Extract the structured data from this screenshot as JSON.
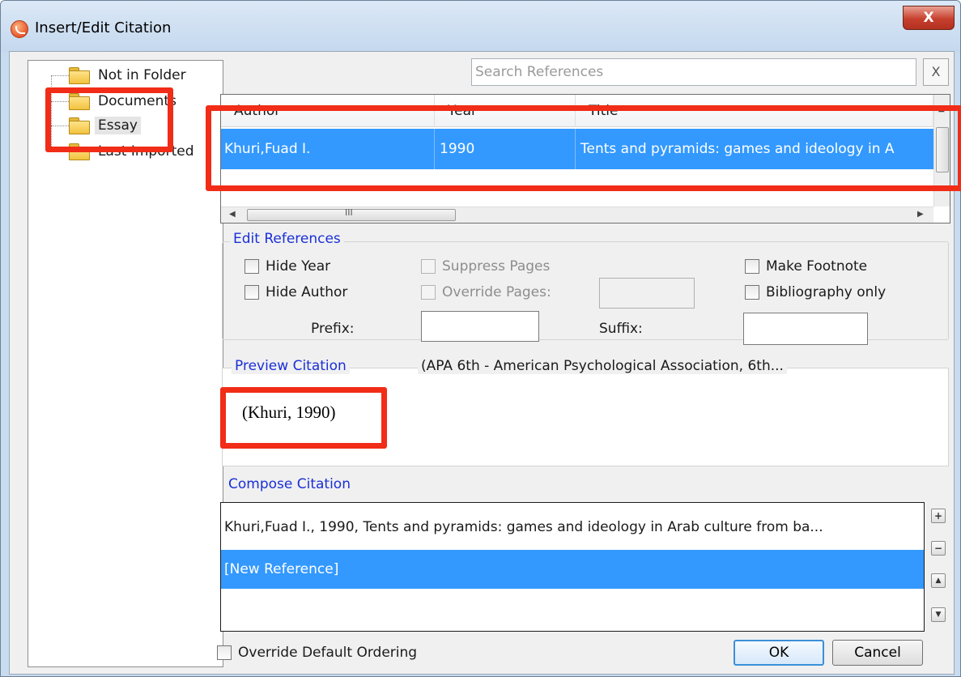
{
  "window": {
    "title": "Insert/Edit Citation",
    "close_label": "X"
  },
  "tree": {
    "items": [
      {
        "label": "Not in Folder"
      },
      {
        "label": "Documents"
      },
      {
        "label": "Essay"
      },
      {
        "label": "Last Imported"
      }
    ]
  },
  "search": {
    "placeholder": "Search References",
    "clear_label": "X"
  },
  "references": {
    "columns": [
      "Author",
      "Year",
      "Title"
    ],
    "rows": [
      {
        "author": "Khuri,Fuad I.",
        "year": "1990",
        "title": "Tents and pyramids: games and ideology in A"
      }
    ],
    "scroll_grip": "III"
  },
  "edit_references": {
    "title": "Edit References",
    "hide_year": "Hide Year",
    "hide_author": "Hide Author",
    "suppress_pages": "Suppress Pages",
    "override_pages": "Override Pages:",
    "make_footnote": "Make Footnote",
    "bibliography_only": "Bibliography only",
    "prefix": "Prefix:",
    "suffix": "Suffix:"
  },
  "preview": {
    "title": "Preview Citation",
    "style": "(APA 6th - American Psychological Association, 6th...",
    "text": "(Khuri, 1990)"
  },
  "compose": {
    "title": "Compose Citation",
    "rows": [
      "Khuri,Fuad I., 1990, Tents and pyramids: games and ideology in Arab culture from ba...",
      "[New Reference]"
    ],
    "add_symbol": "+",
    "remove_symbol": "−",
    "up_symbol": "▲",
    "down_symbol": "▼"
  },
  "footer": {
    "override_ordering": "Override Default Ordering",
    "ok": "OK",
    "cancel": "Cancel"
  },
  "colors": {
    "selection": "#3399ff",
    "highlight": "#f12c17",
    "group_title": "#1a2fd8"
  }
}
